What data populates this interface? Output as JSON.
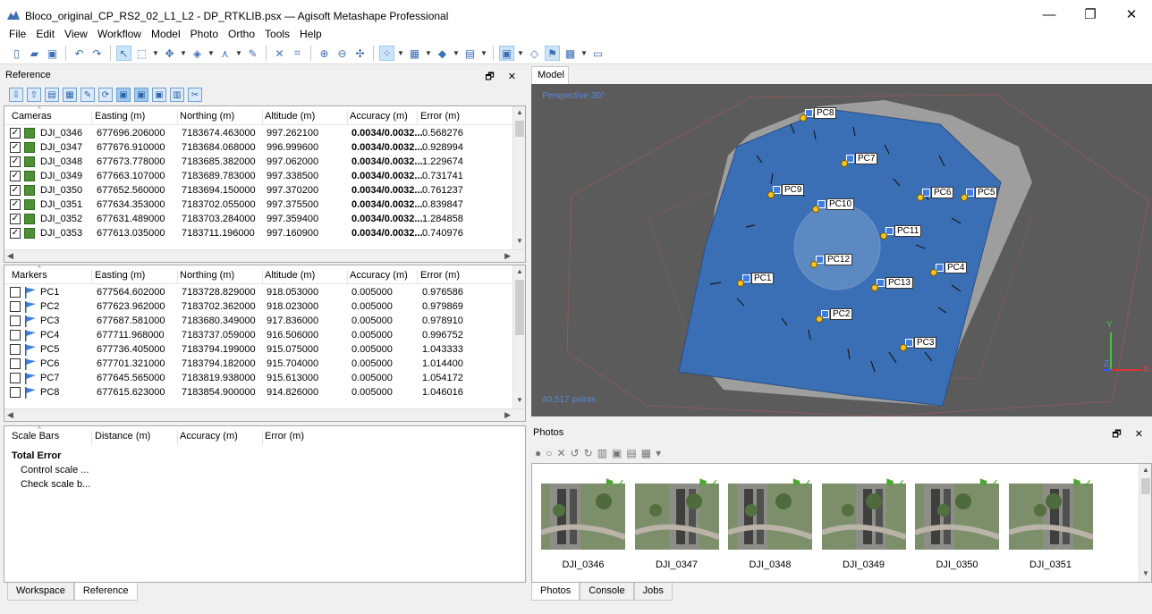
{
  "window": {
    "title": "Bloco_original_CP_RS2_02_L1_L2 - DP_RTKLIB.psx — Agisoft Metashape Professional",
    "controls": [
      "—",
      "❐",
      "✕"
    ]
  },
  "menu": [
    "File",
    "Edit",
    "View",
    "Workflow",
    "Model",
    "Photo",
    "Ortho",
    "Tools",
    "Help"
  ],
  "reference": {
    "title": "Reference",
    "panel_controls": "🗗 ✕",
    "cameras": {
      "columns": [
        "Cameras",
        "Easting (m)",
        "Northing (m)",
        "Altitude (m)",
        "Accuracy (m)",
        "Error (m)"
      ],
      "rows": [
        {
          "name": "DJI_0346",
          "easting": "677696.206000",
          "northing": "7183674.463000",
          "altitude": "997.262100",
          "accuracy": "0.0034/0.0032...",
          "error": "0.568276"
        },
        {
          "name": "DJI_0347",
          "easting": "677676.910000",
          "northing": "7183684.068000",
          "altitude": "996.999600",
          "accuracy": "0.0034/0.0032...",
          "error": "0.928994"
        },
        {
          "name": "DJI_0348",
          "easting": "677673.778000",
          "northing": "7183685.382000",
          "altitude": "997.062000",
          "accuracy": "0.0034/0.0032...",
          "error": "1.229674"
        },
        {
          "name": "DJI_0349",
          "easting": "677663.107000",
          "northing": "7183689.783000",
          "altitude": "997.338500",
          "accuracy": "0.0034/0.0032...",
          "error": "0.731741"
        },
        {
          "name": "DJI_0350",
          "easting": "677652.560000",
          "northing": "7183694.150000",
          "altitude": "997.370200",
          "accuracy": "0.0034/0.0032...",
          "error": "0.761237"
        },
        {
          "name": "DJI_0351",
          "easting": "677634.353000",
          "northing": "7183702.055000",
          "altitude": "997.375500",
          "accuracy": "0.0034/0.0032...",
          "error": "0.839847"
        },
        {
          "name": "DJI_0352",
          "easting": "677631.489000",
          "northing": "7183703.284000",
          "altitude": "997.359400",
          "accuracy": "0.0034/0.0032...",
          "error": "1.284858"
        },
        {
          "name": "DJI_0353",
          "easting": "677613.035000",
          "northing": "7183711.196000",
          "altitude": "997.160900",
          "accuracy": "0.0034/0.0032...",
          "error": "0.740976"
        }
      ]
    },
    "markers": {
      "columns": [
        "Markers",
        "Easting (m)",
        "Northing (m)",
        "Altitude (m)",
        "Accuracy (m)",
        "Error (m)"
      ],
      "rows": [
        {
          "name": "PC1",
          "easting": "677564.602000",
          "northing": "7183728.829000",
          "altitude": "918.053000",
          "accuracy": "0.005000",
          "error": "0.976586"
        },
        {
          "name": "PC2",
          "easting": "677623.962000",
          "northing": "7183702.362000",
          "altitude": "918.023000",
          "accuracy": "0.005000",
          "error": "0.979869"
        },
        {
          "name": "PC3",
          "easting": "677687.581000",
          "northing": "7183680.349000",
          "altitude": "917.836000",
          "accuracy": "0.005000",
          "error": "0.978910"
        },
        {
          "name": "PC4",
          "easting": "677711.968000",
          "northing": "7183737.059000",
          "altitude": "916.506000",
          "accuracy": "0.005000",
          "error": "0.996752"
        },
        {
          "name": "PC5",
          "easting": "677736.405000",
          "northing": "7183794.199000",
          "altitude": "915.075000",
          "accuracy": "0.005000",
          "error": "1.043333"
        },
        {
          "name": "PC6",
          "easting": "677701.321000",
          "northing": "7183794.182000",
          "altitude": "915.704000",
          "accuracy": "0.005000",
          "error": "1.014400"
        },
        {
          "name": "PC7",
          "easting": "677645.565000",
          "northing": "7183819.938000",
          "altitude": "915.613000",
          "accuracy": "0.005000",
          "error": "1.054172"
        },
        {
          "name": "PC8",
          "easting": "677615.623000",
          "northing": "7183854.900000",
          "altitude": "914.826000",
          "accuracy": "0.005000",
          "error": "1.046016"
        }
      ]
    },
    "scalebars": {
      "columns": [
        "Scale Bars",
        "Distance (m)",
        "Accuracy (m)",
        "Error (m)"
      ],
      "total_error": "Total Error",
      "items": [
        "Control scale ...",
        "Check scale b..."
      ]
    },
    "tabs": [
      "Workspace",
      "Reference"
    ]
  },
  "model": {
    "tab": "Model",
    "projection": "Perspective 30°",
    "points": "40,517 points",
    "axes": {
      "y": "Y",
      "z": "Z",
      "x": "X"
    },
    "markers": [
      "PC8",
      "PC7",
      "PC9",
      "PC10",
      "PC6",
      "PC5",
      "PC11",
      "PC12",
      "PC4",
      "PC1",
      "PC13",
      "PC2",
      "PC3"
    ],
    "colors": {
      "background": "#5b5b5b",
      "mesh": "#3a6fb5",
      "marker_dot": "#f3c31e",
      "accent": "#5a86d6"
    }
  },
  "photos": {
    "title": "Photos",
    "panel_controls": "🗗 ✕",
    "items": [
      "DJI_0346",
      "DJI_0347",
      "DJI_0348",
      "DJI_0349",
      "DJI_0350",
      "DJI_0351"
    ],
    "tabs": [
      "Photos",
      "Console",
      "Jobs"
    ]
  }
}
